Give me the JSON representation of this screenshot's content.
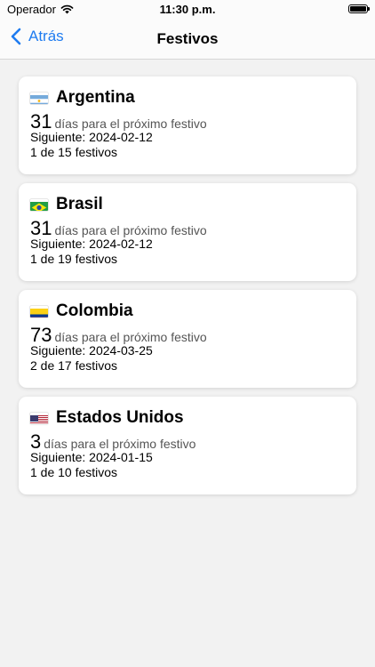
{
  "status_bar": {
    "carrier": "Operador",
    "time": "11:30 p.m."
  },
  "nav": {
    "back_label": "Atrás",
    "title": "Festivos"
  },
  "countries": [
    {
      "name": "Argentina",
      "flag_icon": "argentina-flag-icon",
      "days": "31",
      "days_text": "días para el próximo festivo",
      "next": "Siguiente: 2024-02-12",
      "count": "1 de 15 festivos"
    },
    {
      "name": "Brasil",
      "flag_icon": "brazil-flag-icon",
      "days": "31",
      "days_text": "días para el próximo festivo",
      "next": "Siguiente: 2024-02-12",
      "count": "1 de 19 festivos"
    },
    {
      "name": "Colombia",
      "flag_icon": "colombia-flag-icon",
      "days": "73",
      "days_text": "días para el próximo festivo",
      "next": "Siguiente: 2024-03-25",
      "count": "2 de 17 festivos"
    },
    {
      "name": "Estados Unidos",
      "flag_icon": "usa-flag-icon",
      "days": "3",
      "days_text": "días para el próximo festivo",
      "next": "Siguiente: 2024-01-15",
      "count": "1 de 10 festivos"
    }
  ],
  "colors": {
    "accent": "#1f7cf0",
    "background": "#f2f2f2"
  }
}
